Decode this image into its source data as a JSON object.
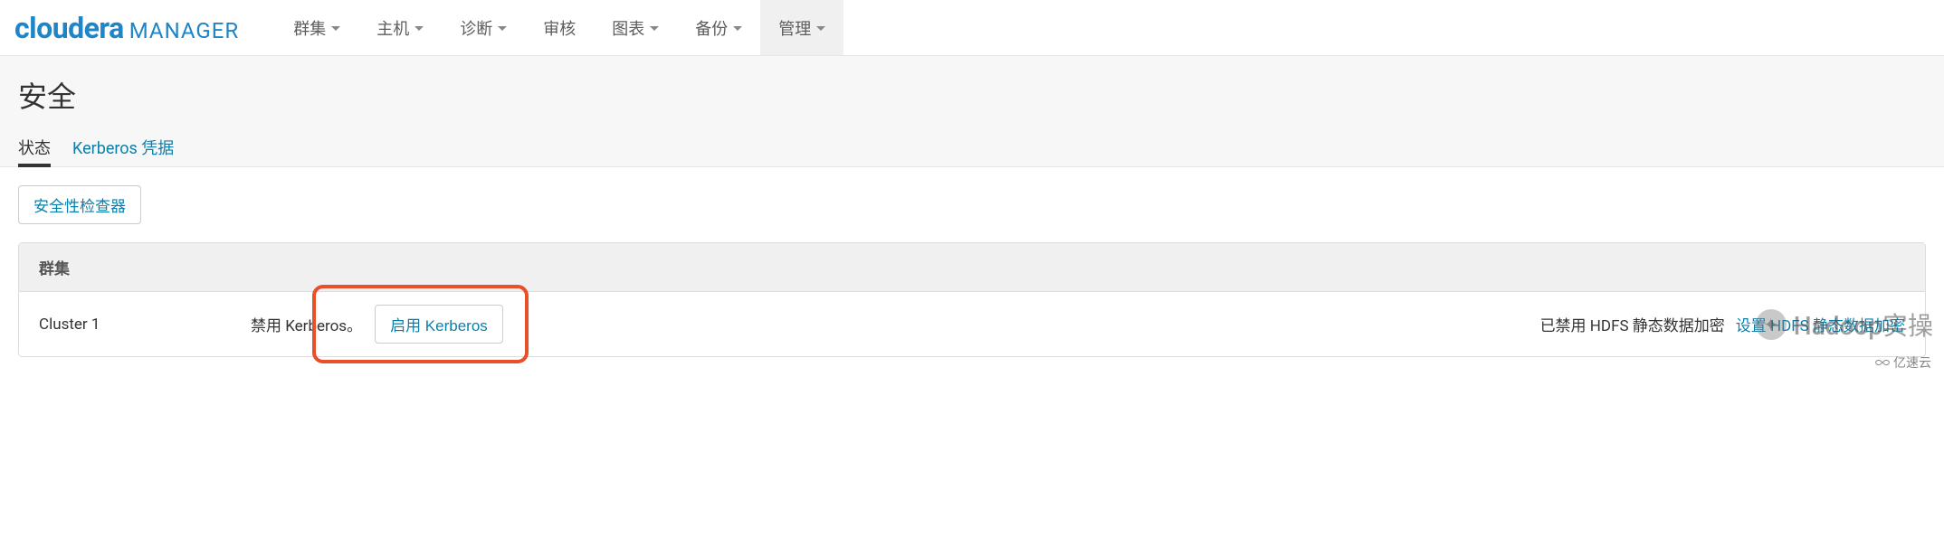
{
  "logo": {
    "brand": "cloudera",
    "product": "MANAGER"
  },
  "nav": {
    "items": [
      {
        "label": "群集",
        "hasCaret": true,
        "active": false
      },
      {
        "label": "主机",
        "hasCaret": true,
        "active": false
      },
      {
        "label": "诊断",
        "hasCaret": true,
        "active": false
      },
      {
        "label": "审核",
        "hasCaret": false,
        "active": false
      },
      {
        "label": "图表",
        "hasCaret": true,
        "active": false
      },
      {
        "label": "备份",
        "hasCaret": true,
        "active": false
      },
      {
        "label": "管理",
        "hasCaret": true,
        "active": true
      }
    ]
  },
  "page": {
    "title": "安全"
  },
  "tabs": {
    "items": [
      {
        "label": "状态",
        "active": true
      },
      {
        "label": "Kerberos 凭据",
        "active": false
      }
    ]
  },
  "actions": {
    "securityChecker": "安全性检查器"
  },
  "panel": {
    "header": "群集",
    "row": {
      "clusterName": "Cluster 1",
      "kerberosStatus": "禁用 Kerberos。",
      "enableKerberos": "启用 Kerberos",
      "hdfsEncryptionStatus": "已禁用 HDFS 静态数据加密",
      "setupHdfsEncryption": "设置 HDFS 静态数据加密"
    }
  },
  "watermark": {
    "text": "Hadoop实操",
    "footer": "亿速云"
  }
}
